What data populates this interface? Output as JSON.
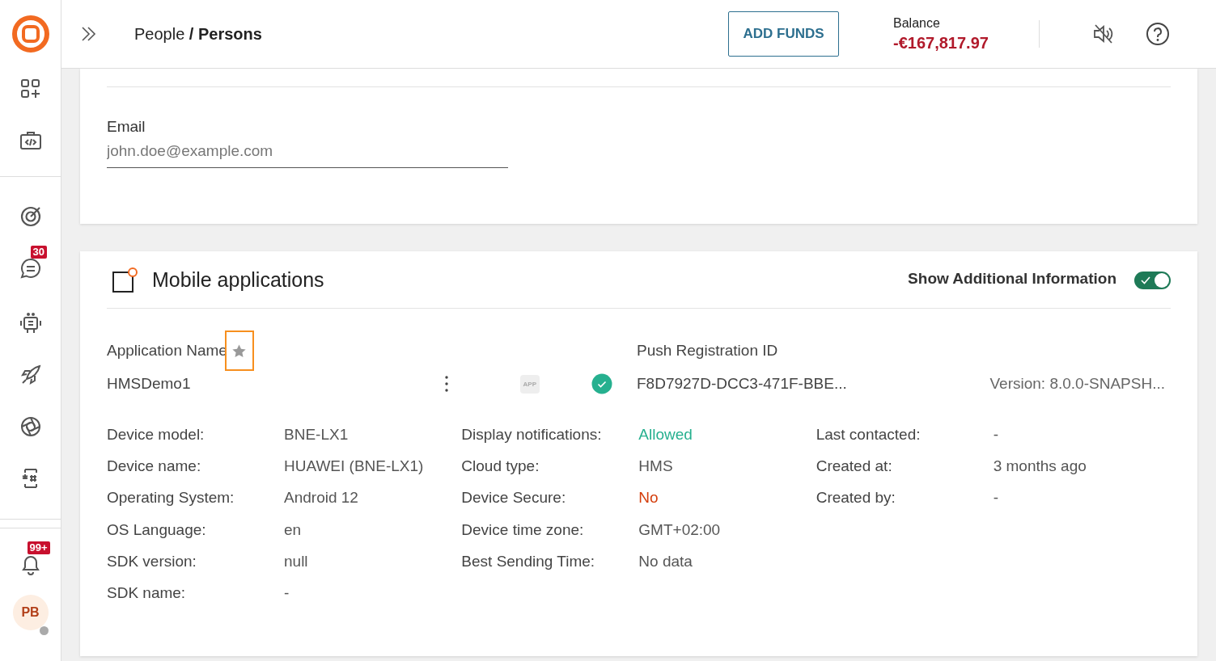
{
  "sidebar": {
    "chat_badge": "30",
    "notification_badge": "99+",
    "avatar": {
      "initials": "PB",
      "online": false
    }
  },
  "header": {
    "breadcrumb": "People **/ Persons**",
    "add_funds": "ADD FUNDS",
    "balance_label": "Balance",
    "balance_value": "-€167,817.97",
    "sound_muted": true
  },
  "email_card": {
    "field_label": "Email",
    "placeholder": "john.doe@example.com"
  },
  "mobile_card": {
    "title": "Mobile applications",
    "toggle": {
      "label": "Show Additional Information",
      "on": true
    },
    "app": {
      "name_label": "Application Name",
      "name": "HMSDemo1",
      "app_badge": "APP",
      "verified": true,
      "push_label": "Push Registration ID",
      "push_id": "F8D7927D-DCC3-471F-BBE...",
      "version": "Version: 8.0.0-SNAPSH..."
    },
    "details": [
      [
        {
          "label": "Device model:",
          "value": "BNE-LX1"
        },
        {
          "label": "Device name:",
          "value": "HUAWEI (BNE-LX1)"
        },
        {
          "label": "Operating System:",
          "value": "Android 12"
        },
        {
          "label": "OS Language:",
          "value": "en"
        },
        {
          "label": "SDK version:",
          "value": "null"
        },
        {
          "label": "SDK name:",
          "value": "-"
        }
      ],
      [
        {
          "label": "Display notifications:",
          "value": "Allowed",
          "color": "#26b08f"
        },
        {
          "label": "Cloud type:",
          "value": "HMS"
        },
        {
          "label": "Device Secure:",
          "value": "No",
          "color": "#d43d0b"
        },
        {
          "label": "Device time zone:",
          "value": "GMT+02:00"
        },
        {
          "label": "Best Sending Time:",
          "value": "No data"
        }
      ],
      [
        {
          "label": "Last contacted:",
          "value": "-"
        },
        {
          "label": "Created at:",
          "value": "3 months ago"
        },
        {
          "label": "Created by:",
          "value": "-"
        }
      ]
    ]
  }
}
